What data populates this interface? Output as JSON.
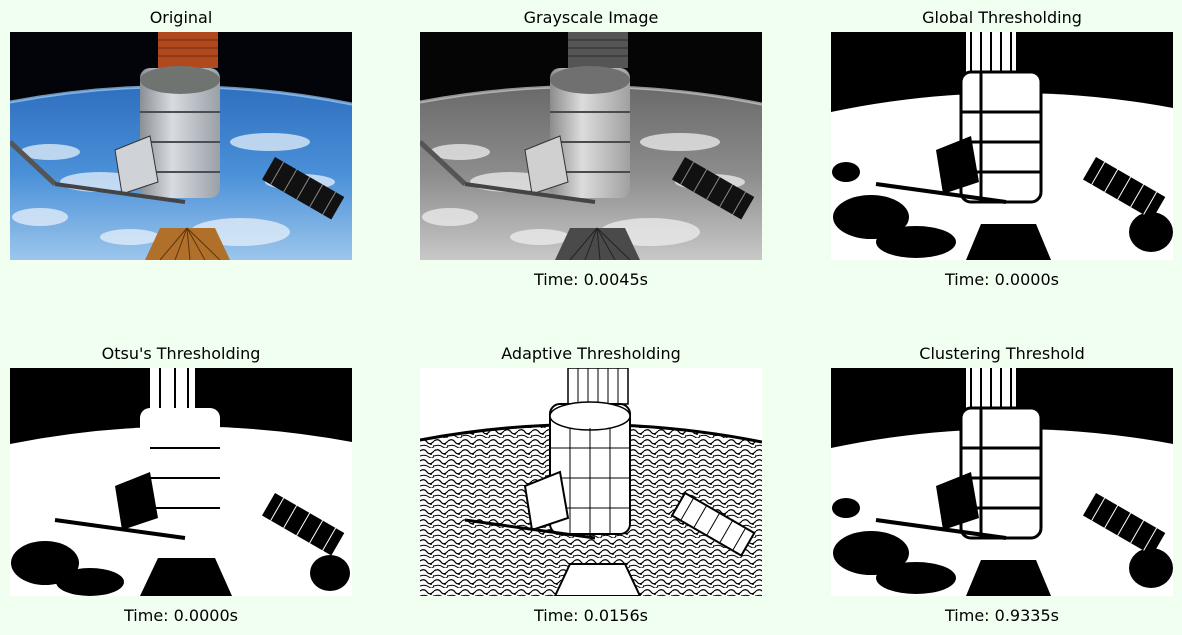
{
  "panels": [
    {
      "title": "Original",
      "caption": ""
    },
    {
      "title": "Grayscale Image",
      "caption": "Time: 0.0045s"
    },
    {
      "title": "Global Thresholding",
      "caption": "Time: 0.0000s"
    },
    {
      "title": "Otsu's Thresholding",
      "caption": "Time: 0.0000s"
    },
    {
      "title": "Adaptive Thresholding",
      "caption": "Time: 0.0156s"
    },
    {
      "title": "Clustering Threshold",
      "caption": "Time: 0.9335s"
    }
  ],
  "colors": {
    "background": "#f0fff0"
  }
}
